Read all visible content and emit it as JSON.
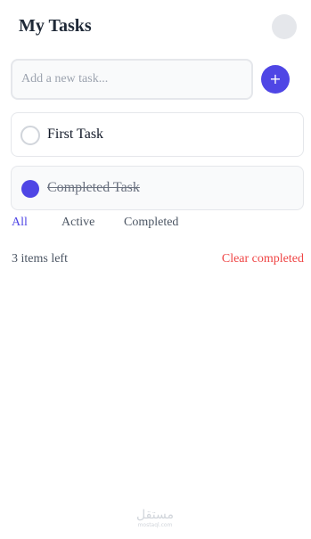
{
  "header": {
    "title": "My Tasks"
  },
  "new_task": {
    "placeholder": "Add a new task...",
    "value": "",
    "add_label": "+"
  },
  "tasks": [
    {
      "label": "First Task",
      "completed": false
    },
    {
      "label": "Completed Task",
      "completed": true
    }
  ],
  "filters": [
    {
      "label": "All",
      "active": true
    },
    {
      "label": "Active",
      "active": false
    },
    {
      "label": "Completed",
      "active": false
    }
  ],
  "footer": {
    "items_left": "3 items left",
    "clear_label": "Clear completed"
  },
  "watermark": {
    "mark": "مستقل",
    "sub": "mostaql.com"
  },
  "colors": {
    "accent": "#4f46e5",
    "danger": "#ef4444",
    "border": "#e5e7eb",
    "muted_text": "#4b5563"
  },
  "icons": {
    "add": "plus-icon",
    "unchecked": "empty-circle-icon",
    "checked": "filled-circle-icon"
  }
}
